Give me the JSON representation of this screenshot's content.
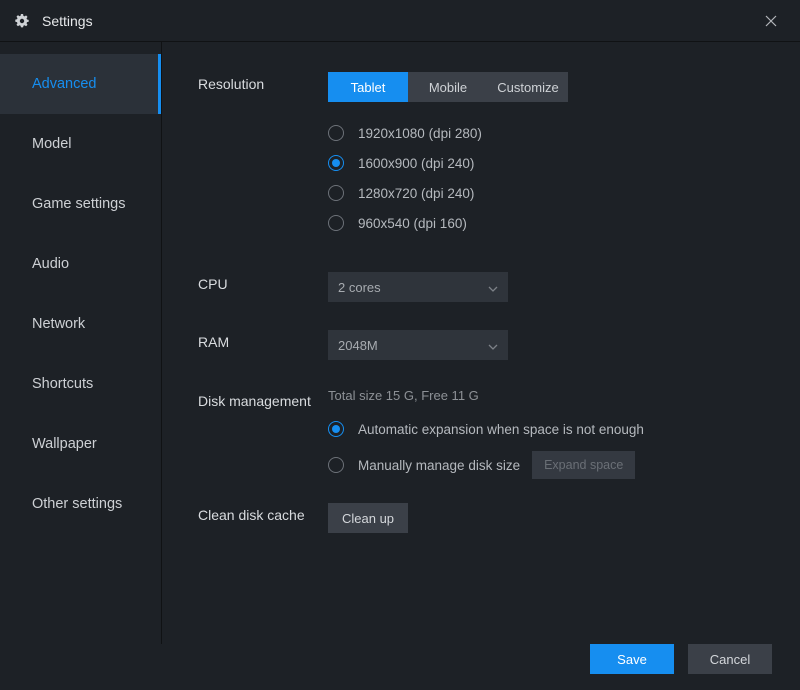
{
  "window": {
    "title": "Settings"
  },
  "sidebar": {
    "items": [
      {
        "label": "Advanced"
      },
      {
        "label": "Model"
      },
      {
        "label": "Game settings"
      },
      {
        "label": "Audio"
      },
      {
        "label": "Network"
      },
      {
        "label": "Shortcuts"
      },
      {
        "label": "Wallpaper"
      },
      {
        "label": "Other settings"
      }
    ],
    "active_index": 0
  },
  "resolution": {
    "label": "Resolution",
    "tabs": [
      "Tablet",
      "Mobile",
      "Customize"
    ],
    "active_tab": "Tablet",
    "options": [
      "1920x1080  (dpi 280)",
      "1600x900  (dpi 240)",
      "1280x720  (dpi 240)",
      "960x540  (dpi 160)"
    ],
    "selected_index": 1
  },
  "cpu": {
    "label": "CPU",
    "value": "2 cores"
  },
  "ram": {
    "label": "RAM",
    "value": "2048M"
  },
  "disk": {
    "label": "Disk management",
    "status": "Total size 15 G,  Free 11 G",
    "options": [
      "Automatic expansion when space is not enough",
      "Manually manage disk size"
    ],
    "selected_index": 0,
    "expand_btn": "Expand space"
  },
  "cache": {
    "label": "Clean disk cache",
    "button": "Clean up"
  },
  "footer": {
    "save": "Save",
    "cancel": "Cancel"
  }
}
